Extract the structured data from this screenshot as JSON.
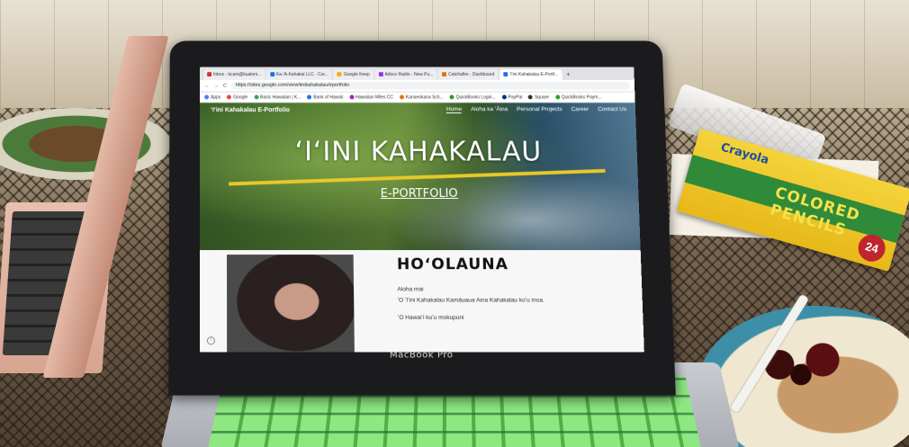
{
  "browser": {
    "tabs": [
      {
        "label": "Inbox - kcam@kualoni...",
        "color": "#d93025"
      },
      {
        "label": "Ka-'A-Kahakai LLC - Cor...",
        "color": "#1a73e8"
      },
      {
        "label": "Google Keep",
        "color": "#f9ab00"
      },
      {
        "label": "Adsco Radio - New Pu...",
        "color": "#9334e6"
      },
      {
        "label": "Catchafire - Dashboard",
        "color": "#e8710a"
      },
      {
        "label": "ʻIʻini Kahakalau E-Portf...",
        "color": "#1a73e8"
      }
    ],
    "new_tab": "+",
    "url": "https://sites.google.com/view/iinikahakalau/eportfolio",
    "nav_back": "←",
    "nav_forward": "→",
    "nav_reload": "C",
    "bookmarks": [
      {
        "label": "Apps",
        "color": "#4285f4"
      },
      {
        "label": "Google",
        "color": "#ea4335"
      },
      {
        "label": "Basic Hawaiian | K...",
        "color": "#34a853"
      },
      {
        "label": "Bank of Hawaii",
        "color": "#1a73e8"
      },
      {
        "label": "Hawaiian Miles CC",
        "color": "#9c27b0"
      },
      {
        "label": "Kanaeokana Sch...",
        "color": "#e8710a"
      },
      {
        "label": "QuickBooks Login...",
        "color": "#2ca01c"
      },
      {
        "label": "PayPal",
        "color": "#003087"
      },
      {
        "label": "Square",
        "color": "#333333"
      },
      {
        "label": "QuickBooks Paym...",
        "color": "#2ca01c"
      }
    ]
  },
  "site": {
    "name": "ʻIʻini Kahakalau E-Portfolio",
    "nav": [
      "Home",
      "Aloha ka ʻĀina",
      "Personal Projects",
      "Career",
      "Contact Us"
    ],
    "hero_title": "ʻIʻINI KAHAKALAU",
    "hero_subtitle": "E-PORTFOLIO",
    "section_heading": "HOʻOLAUNA",
    "greeting": "Aloha mai",
    "line1": "ʻO ʻIʻini Kahakalau Kamāuaua Aina Kahakalau koʻu inoa.",
    "line2": "ʻO Hawaiʻi kuʻu mokupuni"
  },
  "laptop": {
    "brand_label": "MacBook Pro"
  },
  "scene": {
    "pencil_brand": "Crayola",
    "pencil_product": "COLORED PENCILS",
    "pencil_count": "24"
  }
}
